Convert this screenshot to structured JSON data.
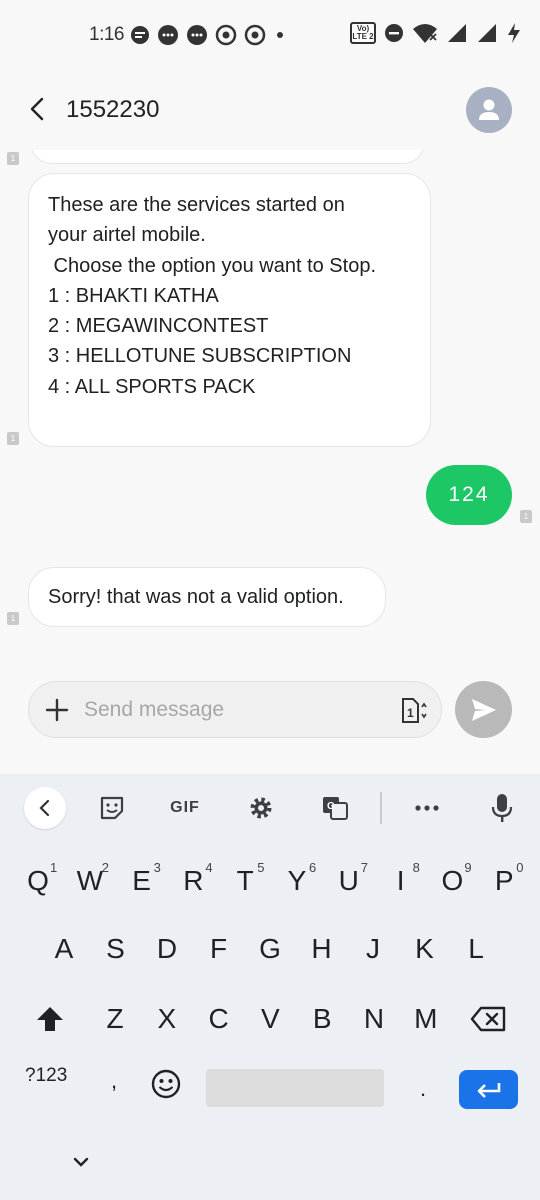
{
  "status_bar": {
    "time": "1:16",
    "volte_top": "Vo)",
    "volte_bottom": "LTE 2"
  },
  "header": {
    "title": "1552230"
  },
  "messages": [
    {
      "direction": "incoming",
      "lines": [
        "These are the services started on",
        "your airtel mobile.",
        " Choose the option you want to Stop.",
        "1 : BHAKTI KATHA",
        "2 : MEGAWINCONTEST",
        "3 : HELLOTUNE SUBSCRIPTION",
        "4 : ALL SPORTS PACK"
      ]
    },
    {
      "direction": "outgoing",
      "text": "124"
    },
    {
      "direction": "incoming",
      "lines": [
        "Sorry! that was not a valid option."
      ]
    }
  ],
  "sim_badge": "1",
  "compose": {
    "placeholder": "Send message",
    "sim_label": "1"
  },
  "keyboard": {
    "toolbar": {
      "gif_label": "GIF"
    },
    "row1": [
      {
        "k": "Q",
        "h": "1"
      },
      {
        "k": "W",
        "h": "2"
      },
      {
        "k": "E",
        "h": "3"
      },
      {
        "k": "R",
        "h": "4"
      },
      {
        "k": "T",
        "h": "5"
      },
      {
        "k": "Y",
        "h": "6"
      },
      {
        "k": "U",
        "h": "7"
      },
      {
        "k": "I",
        "h": "8"
      },
      {
        "k": "O",
        "h": "9"
      },
      {
        "k": "P",
        "h": "0"
      }
    ],
    "row2": [
      "A",
      "S",
      "D",
      "F",
      "G",
      "H",
      "J",
      "K",
      "L"
    ],
    "row3": [
      "Z",
      "X",
      "C",
      "V",
      "B",
      "N",
      "M"
    ],
    "symbols_label": "?123",
    "comma_label": ",",
    "period_label": "."
  },
  "colors": {
    "outgoing_bubble": "#1dc766",
    "enter_key": "#1a73e8",
    "avatar": "#a8b0c4",
    "send_button": "#b9b9b9"
  }
}
